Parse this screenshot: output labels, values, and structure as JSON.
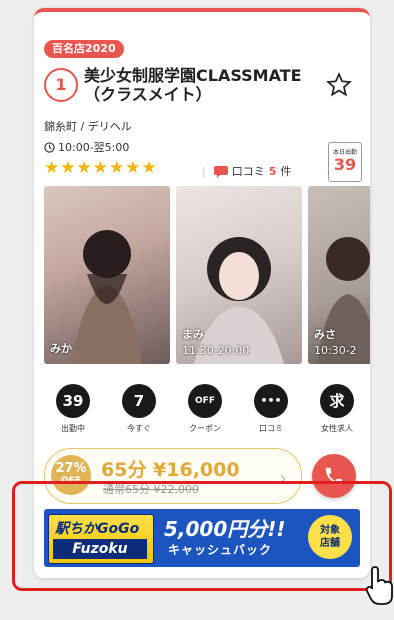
{
  "card": {
    "year_badge": "百名店2020",
    "rank": "1",
    "name": "美少女制服学園CLASSMATE（クラスメイト）",
    "area": "錦糸町 / デリヘル",
    "hours": "10:00-翌5:00",
    "rating_stars": 7,
    "review_label": "口コミ",
    "review_count": "5",
    "review_unit": "件",
    "today_label": "本日出勤",
    "today_count": "39"
  },
  "photos": [
    {
      "name": "みか",
      "time": ""
    },
    {
      "name": "まみ",
      "time": "11:30-20:00"
    },
    {
      "name": "みさ",
      "time": "10:30-2"
    }
  ],
  "actions": [
    {
      "icon": "39",
      "label": "出勤中"
    },
    {
      "icon": "7",
      "label": "今すぐ"
    },
    {
      "icon": "OFF",
      "label": "クーポン"
    },
    {
      "icon": "•••",
      "label": "口コミ"
    },
    {
      "icon": "求",
      "label": "女性求人"
    }
  ],
  "coupon": {
    "off_pct": "27%",
    "off_label": "OFF",
    "price": "65分 ¥16,000",
    "old_price": "通常65分 ¥22,000"
  },
  "banner": {
    "logo_top": "駅ちかGoGo",
    "logo_bottom": "Fuzoku",
    "amount": "5,000円分!!",
    "sub": "キャッシュバック",
    "target_line1": "対象",
    "target_line2": "店舗"
  },
  "colors": {
    "accent": "#e8564f",
    "star": "#f5b400",
    "coupon_gold": "#e2b458",
    "banner_blue": "#1c54c0",
    "highlight_red": "#e02020"
  }
}
